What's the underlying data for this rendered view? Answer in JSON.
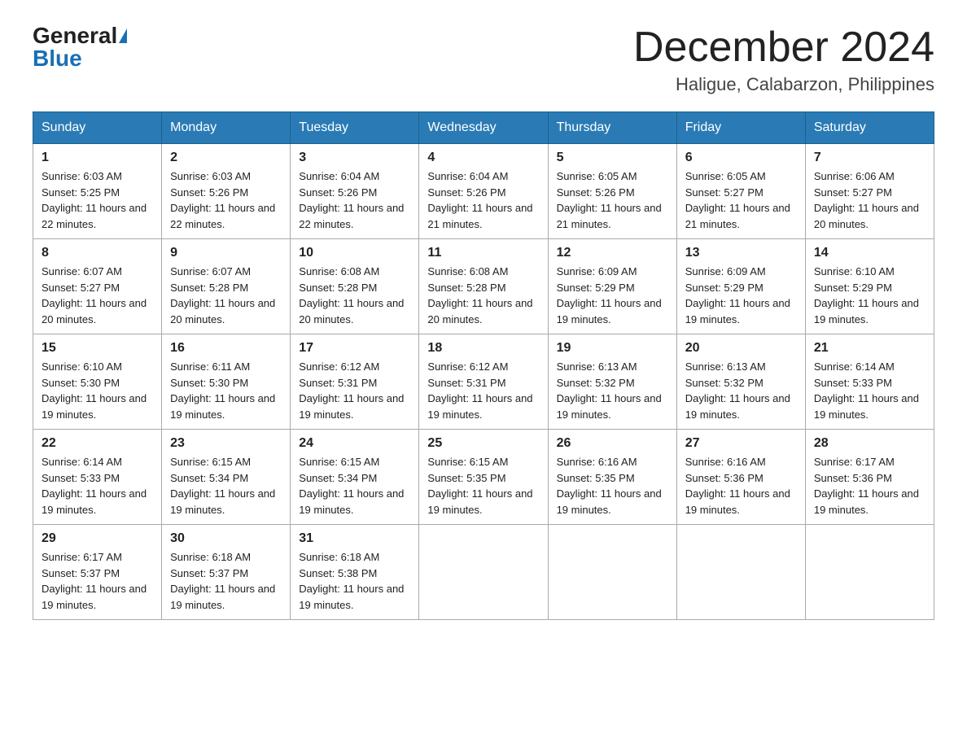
{
  "header": {
    "logo_general": "General",
    "logo_blue": "Blue",
    "month_title": "December 2024",
    "location": "Haligue, Calabarzon, Philippines"
  },
  "days_of_week": [
    "Sunday",
    "Monday",
    "Tuesday",
    "Wednesday",
    "Thursday",
    "Friday",
    "Saturday"
  ],
  "weeks": [
    [
      {
        "day": "1",
        "sunrise": "6:03 AM",
        "sunset": "5:25 PM",
        "daylight": "11 hours and 22 minutes."
      },
      {
        "day": "2",
        "sunrise": "6:03 AM",
        "sunset": "5:26 PM",
        "daylight": "11 hours and 22 minutes."
      },
      {
        "day": "3",
        "sunrise": "6:04 AM",
        "sunset": "5:26 PM",
        "daylight": "11 hours and 22 minutes."
      },
      {
        "day": "4",
        "sunrise": "6:04 AM",
        "sunset": "5:26 PM",
        "daylight": "11 hours and 21 minutes."
      },
      {
        "day": "5",
        "sunrise": "6:05 AM",
        "sunset": "5:26 PM",
        "daylight": "11 hours and 21 minutes."
      },
      {
        "day": "6",
        "sunrise": "6:05 AM",
        "sunset": "5:27 PM",
        "daylight": "11 hours and 21 minutes."
      },
      {
        "day": "7",
        "sunrise": "6:06 AM",
        "sunset": "5:27 PM",
        "daylight": "11 hours and 20 minutes."
      }
    ],
    [
      {
        "day": "8",
        "sunrise": "6:07 AM",
        "sunset": "5:27 PM",
        "daylight": "11 hours and 20 minutes."
      },
      {
        "day": "9",
        "sunrise": "6:07 AM",
        "sunset": "5:28 PM",
        "daylight": "11 hours and 20 minutes."
      },
      {
        "day": "10",
        "sunrise": "6:08 AM",
        "sunset": "5:28 PM",
        "daylight": "11 hours and 20 minutes."
      },
      {
        "day": "11",
        "sunrise": "6:08 AM",
        "sunset": "5:28 PM",
        "daylight": "11 hours and 20 minutes."
      },
      {
        "day": "12",
        "sunrise": "6:09 AM",
        "sunset": "5:29 PM",
        "daylight": "11 hours and 19 minutes."
      },
      {
        "day": "13",
        "sunrise": "6:09 AM",
        "sunset": "5:29 PM",
        "daylight": "11 hours and 19 minutes."
      },
      {
        "day": "14",
        "sunrise": "6:10 AM",
        "sunset": "5:29 PM",
        "daylight": "11 hours and 19 minutes."
      }
    ],
    [
      {
        "day": "15",
        "sunrise": "6:10 AM",
        "sunset": "5:30 PM",
        "daylight": "11 hours and 19 minutes."
      },
      {
        "day": "16",
        "sunrise": "6:11 AM",
        "sunset": "5:30 PM",
        "daylight": "11 hours and 19 minutes."
      },
      {
        "day": "17",
        "sunrise": "6:12 AM",
        "sunset": "5:31 PM",
        "daylight": "11 hours and 19 minutes."
      },
      {
        "day": "18",
        "sunrise": "6:12 AM",
        "sunset": "5:31 PM",
        "daylight": "11 hours and 19 minutes."
      },
      {
        "day": "19",
        "sunrise": "6:13 AM",
        "sunset": "5:32 PM",
        "daylight": "11 hours and 19 minutes."
      },
      {
        "day": "20",
        "sunrise": "6:13 AM",
        "sunset": "5:32 PM",
        "daylight": "11 hours and 19 minutes."
      },
      {
        "day": "21",
        "sunrise": "6:14 AM",
        "sunset": "5:33 PM",
        "daylight": "11 hours and 19 minutes."
      }
    ],
    [
      {
        "day": "22",
        "sunrise": "6:14 AM",
        "sunset": "5:33 PM",
        "daylight": "11 hours and 19 minutes."
      },
      {
        "day": "23",
        "sunrise": "6:15 AM",
        "sunset": "5:34 PM",
        "daylight": "11 hours and 19 minutes."
      },
      {
        "day": "24",
        "sunrise": "6:15 AM",
        "sunset": "5:34 PM",
        "daylight": "11 hours and 19 minutes."
      },
      {
        "day": "25",
        "sunrise": "6:15 AM",
        "sunset": "5:35 PM",
        "daylight": "11 hours and 19 minutes."
      },
      {
        "day": "26",
        "sunrise": "6:16 AM",
        "sunset": "5:35 PM",
        "daylight": "11 hours and 19 minutes."
      },
      {
        "day": "27",
        "sunrise": "6:16 AM",
        "sunset": "5:36 PM",
        "daylight": "11 hours and 19 minutes."
      },
      {
        "day": "28",
        "sunrise": "6:17 AM",
        "sunset": "5:36 PM",
        "daylight": "11 hours and 19 minutes."
      }
    ],
    [
      {
        "day": "29",
        "sunrise": "6:17 AM",
        "sunset": "5:37 PM",
        "daylight": "11 hours and 19 minutes."
      },
      {
        "day": "30",
        "sunrise": "6:18 AM",
        "sunset": "5:37 PM",
        "daylight": "11 hours and 19 minutes."
      },
      {
        "day": "31",
        "sunrise": "6:18 AM",
        "sunset": "5:38 PM",
        "daylight": "11 hours and 19 minutes."
      },
      null,
      null,
      null,
      null
    ]
  ]
}
